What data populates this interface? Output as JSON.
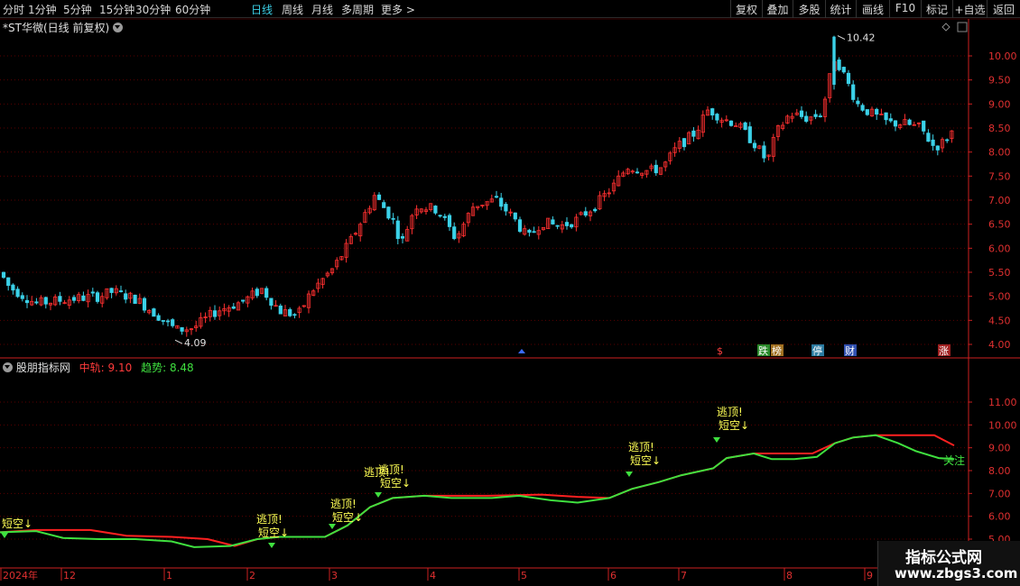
{
  "toolbar": {
    "periods": [
      "分时",
      "1分钟",
      "5分钟",
      "15分钟",
      "30分钟",
      "60分钟",
      "日线",
      "周线",
      "月线",
      "多周期",
      "更多 >"
    ],
    "active_period": "日线",
    "right_buttons": [
      "复权",
      "叠加",
      "多股",
      "统计",
      "画线",
      "F10",
      "标记",
      "+自选",
      "返回"
    ]
  },
  "main_chart": {
    "title": "*ST华微(日线 前复权)",
    "price_axis_ticks": [
      "10.00",
      "9.50",
      "9.00",
      "8.50",
      "8.00",
      "7.50",
      "7.00",
      "6.50",
      "6.00",
      "5.50",
      "5.00",
      "4.50",
      "4.00"
    ],
    "high_label": "10.42",
    "low_label": "4.09",
    "event_markers": [
      "$",
      "跌",
      "榜",
      "停",
      "财",
      "涨"
    ],
    "colors": {
      "up": "#ff3030",
      "down": "#3bd1e8",
      "grid": "#5a0000",
      "axis": "#cc2020"
    }
  },
  "indicator": {
    "name": "股朋指标网",
    "mid_label": "中轨:",
    "mid_value": "9.10",
    "trend_label": "趋势:",
    "trend_value": "8.48",
    "axis_ticks": [
      "11.00",
      "10.00",
      "9.00",
      "8.00",
      "7.00",
      "6.00",
      "5.00"
    ],
    "signal_texts": {
      "short": "短空↓",
      "escape": "逃顶!"
    },
    "focus_label": "关注",
    "colors": {
      "mid": "#ff2020",
      "trend": "#3fe03f",
      "signal": "#ffff55"
    }
  },
  "date_axis": {
    "labels": [
      "2024年",
      "12",
      "1",
      "2",
      "3",
      "4",
      "5",
      "6",
      "7",
      "8",
      "9"
    ]
  },
  "watermark": {
    "line1": "指标公式网",
    "line2": "www.zbgs3.com"
  }
}
